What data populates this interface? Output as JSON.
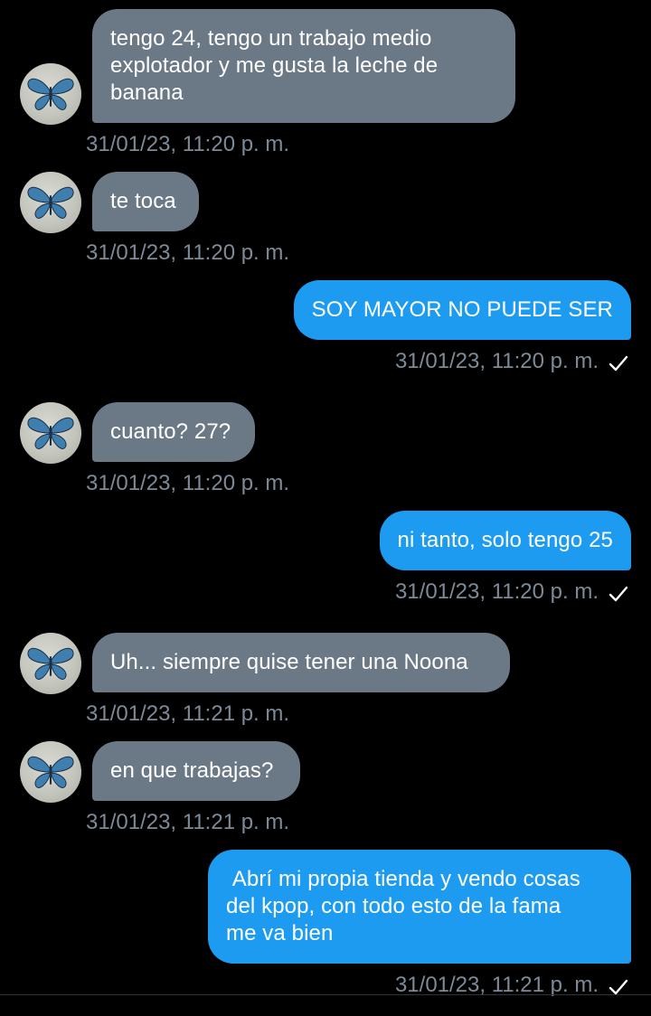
{
  "messages": [
    {
      "side": "in",
      "text": "tengo 24, tengo un trabajo medio\nexplotador y me gusta la leche de\nbanana",
      "time": "31/01/23, 11:20 p. m."
    },
    {
      "side": "in",
      "text": "te toca",
      "time": "31/01/23, 11:20 p. m."
    },
    {
      "side": "out",
      "text": "SOY MAYOR NO PUEDE SER",
      "time": "31/01/23, 11:20 p. m.",
      "status": "check-icon"
    },
    {
      "side": "in",
      "text": "cuanto? 27?",
      "time": "31/01/23, 11:20 p. m."
    },
    {
      "side": "out",
      "text": "ni tanto, solo tengo 25",
      "time": "31/01/23, 11:20 p. m.",
      "status": "check-icon"
    },
    {
      "side": "in",
      "text": "Uh... siempre quise tener una Noona",
      "time": "31/01/23, 11:21 p. m."
    },
    {
      "side": "in",
      "text": "en que trabajas?",
      "time": "31/01/23, 11:21 p. m."
    },
    {
      "side": "out",
      "text": " Abrí mi propia tienda y vendo cosas\ndel kpop, con todo esto de la fama\nme va bien",
      "time": "31/01/23, 11:21 p. m.",
      "status": "check-icon"
    }
  ],
  "colors": {
    "background": "#000000",
    "incoming_bubble": "#6b7886",
    "outgoing_bubble": "#1d9bf0",
    "timestamp": "#7d8a97"
  },
  "avatar_icon": "butterfly-icon"
}
